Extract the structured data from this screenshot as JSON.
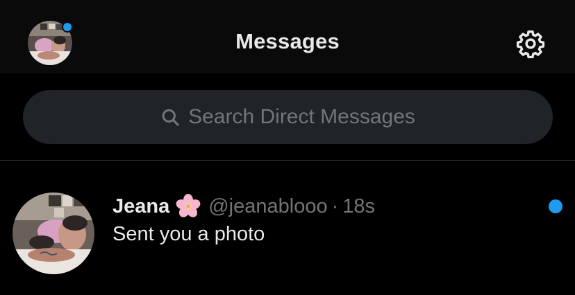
{
  "header": {
    "title": "Messages",
    "avatar_icon": "profile-avatar",
    "settings_icon": "gear-icon",
    "notification_dot_color": "#1d9bf0"
  },
  "search": {
    "placeholder": "Search Direct Messages",
    "icon": "search-icon"
  },
  "conversations": [
    {
      "name": "Jeana",
      "name_emoji": "🌸",
      "handle": "@jeanablooo",
      "separator": "·",
      "time": "18s",
      "preview": "Sent you a photo",
      "unread": true
    }
  ],
  "colors": {
    "background": "#000000",
    "header_background": "#0a0a0b",
    "search_background": "#202327",
    "primary_text": "#e7e9ea",
    "secondary_text": "#71767b",
    "accent": "#1d9bf0",
    "divider": "#2f3336"
  }
}
